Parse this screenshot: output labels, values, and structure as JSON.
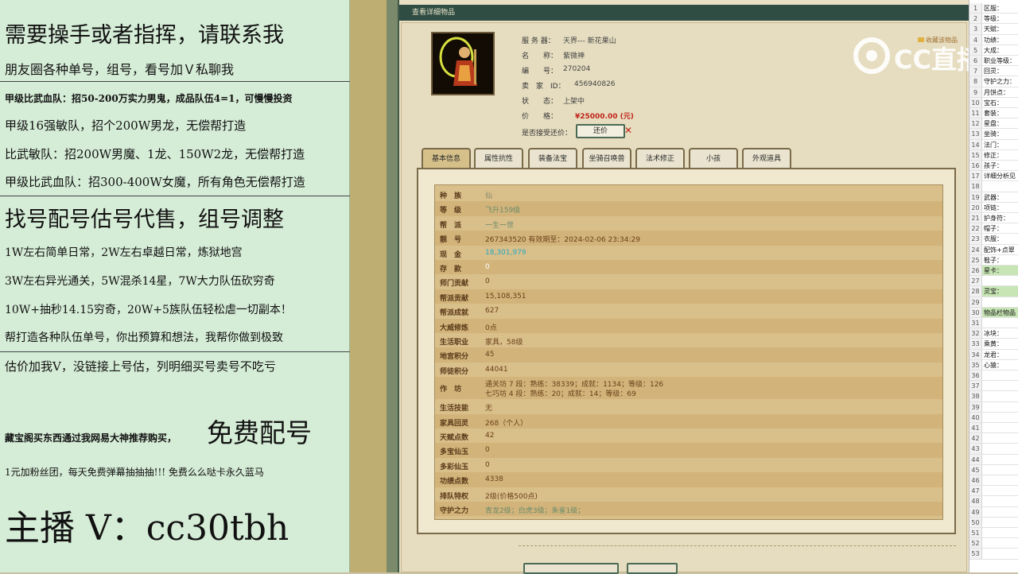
{
  "left_ad": {
    "lines": [
      "需要操手或者指挥，请联系我",
      "朋友圈各种单号，组号，看号加Ｖ私聊我",
      "甲级比武血队：招50-200万实力男鬼，成品队伍4=1，可慢慢投资",
      "甲级16强敏队，招个200W男龙，无偿帮打造",
      "比武敏队：招200W男魔、1龙、150W2龙，无偿帮打造",
      "甲级比武血队：招300-400W女魔，所有角色无偿帮打造",
      "找号配号估号代售，组号调整",
      "1W左右简单日常，2W左右卓越日常，炼狱地宫",
      "3W左右异光通关，5W混杀14星，7W大力队伍砍穷奇",
      "10W+抽秒14.15穷奇，20W+5族队伍轻松虐一切副本！",
      "帮打造各种队伍单号，你出预算和想法，我帮你做到极致",
      "估价加我V，没链接上号估，列明细买号卖号不吃亏",
      "藏宝阁买东西通过我网易大神推荐购买，",
      "免费配号",
      "1元加粉丝团，每天免费弹幕抽抽抽!!! 免费么么哒卡永久蓝马",
      "主播 V：cc30tbh"
    ]
  },
  "window": {
    "title": "查看详细物品",
    "favorite": "收藏该物品",
    "info": [
      {
        "label": "服 务 器：",
        "value": "天界--- 新花果山"
      },
      {
        "label": "名　　称：",
        "value": "紫微神"
      },
      {
        "label": "编　　号：",
        "value": "270204"
      },
      {
        "label": "卖　家　ID：",
        "value": "456940826"
      },
      {
        "label": "状　　态：",
        "value": "上架中"
      },
      {
        "label": "价　　格：",
        "value": "¥25000.00 (元)"
      }
    ],
    "counter_label": "是否接受还价：",
    "counter_button": "还价",
    "counter_x": "✕",
    "tabs": [
      "基本信息",
      "属性抗性",
      "装备法宝",
      "坐骑召唤兽",
      "法术修正",
      "小孩",
      "外观道具"
    ],
    "rows": [
      {
        "k": "种　族",
        "v": "仙",
        "c": "#8a8a6a"
      },
      {
        "k": "等　级",
        "v": "飞升159级",
        "c": "#6a8a6a"
      },
      {
        "k": "帮　派",
        "v": "一生一世",
        "c": "#6a8a6a"
      },
      {
        "k": "靓　号",
        "v": "267343520   有效期至：2024-02-06 23:34:29",
        "c": "#6a3f1a"
      },
      {
        "k": "现　金",
        "v": "18,301,979",
        "c": "#2aa8c0"
      },
      {
        "k": "存　款",
        "v": "0",
        "c": "#ffffff"
      },
      {
        "k": "师门贡献",
        "v": "0",
        "c": "#6a3f1a"
      },
      {
        "k": "帮派贡献",
        "v": "15,108,351",
        "c": "#6a3f1a"
      },
      {
        "k": "帮派成就",
        "v": "627",
        "c": "#6a3f1a"
      },
      {
        "k": "大威修炼",
        "v": "0点",
        "c": "#6a3f1a"
      },
      {
        "k": "生活职业",
        "v": "家具，58级",
        "c": "#6a3f1a"
      },
      {
        "k": "地宫积分",
        "v": "45",
        "c": "#6a3f1a"
      },
      {
        "k": "师徒积分",
        "v": "44041",
        "c": "#6a3f1a"
      },
      {
        "k": "作　坊",
        "v": "通关坊 7 段：熟练：38339；成就：1134；等级：126",
        "v2": "七巧坊 4 段：熟练：20；成就：14；等级：69",
        "c": "#6a3f1a"
      },
      {
        "k": "生活技能",
        "v": "无",
        "c": "#6a3f1a"
      },
      {
        "k": "家具回灵",
        "v": "268（个人）",
        "c": "#6a3f1a"
      },
      {
        "k": "天赋点数",
        "v": "42",
        "c": "#6a3f1a"
      },
      {
        "k": "多宝仙玉",
        "v": "0",
        "c": "#6a3f1a"
      },
      {
        "k": "多彩仙玉",
        "v": "0",
        "c": "#6a3f1a"
      },
      {
        "k": "功绩点数",
        "v": "4338",
        "c": "#6a3f1a"
      },
      {
        "k": "排队特权",
        "v": "2级(价格500点)",
        "c": "#6a3f1a"
      },
      {
        "k": "守护之力",
        "v": "青龙2级；白虎3级；朱雀1级；",
        "c": "#6a8a6a"
      }
    ]
  },
  "logo": {
    "text": "CC直播"
  },
  "sheet": {
    "rows": [
      {
        "n": "1",
        "t": "区服："
      },
      {
        "n": "2",
        "t": "等级："
      },
      {
        "n": "3",
        "t": "天赋："
      },
      {
        "n": "4",
        "t": "功绩："
      },
      {
        "n": "5",
        "t": "大成："
      },
      {
        "n": "6",
        "t": "职业等级："
      },
      {
        "n": "7",
        "t": "回灵："
      },
      {
        "n": "8",
        "t": "守护之力："
      },
      {
        "n": "9",
        "t": "月饼点："
      },
      {
        "n": "10",
        "t": "宝石："
      },
      {
        "n": "11",
        "t": "套装："
      },
      {
        "n": "12",
        "t": "星盘："
      },
      {
        "n": "13",
        "t": "坐骑："
      },
      {
        "n": "14",
        "t": "法门："
      },
      {
        "n": "15",
        "t": "修正："
      },
      {
        "n": "16",
        "t": "孩子："
      },
      {
        "n": "17",
        "t": "详细分析见"
      },
      {
        "n": "18",
        "t": ""
      },
      {
        "n": "19",
        "t": "武器："
      },
      {
        "n": "20",
        "t": "项链："
      },
      {
        "n": "21",
        "t": "护身符："
      },
      {
        "n": "22",
        "t": "帽子："
      },
      {
        "n": "23",
        "t": "衣服："
      },
      {
        "n": "24",
        "t": "配饰+点翠"
      },
      {
        "n": "25",
        "t": "鞋子："
      },
      {
        "n": "26",
        "t": "星卡：",
        "hl": true
      },
      {
        "n": "27",
        "t": ""
      },
      {
        "n": "28",
        "t": "灵宝：",
        "hl": true
      },
      {
        "n": "29",
        "t": ""
      },
      {
        "n": "30",
        "t": "物品栏物品",
        "hl": true
      },
      {
        "n": "31",
        "t": ""
      },
      {
        "n": "32",
        "t": "冰块："
      },
      {
        "n": "33",
        "t": "乘黄："
      },
      {
        "n": "34",
        "t": "龙君："
      },
      {
        "n": "35",
        "t": "心猿："
      },
      {
        "n": "36",
        "t": ""
      },
      {
        "n": "37",
        "t": ""
      },
      {
        "n": "38",
        "t": ""
      },
      {
        "n": "39",
        "t": ""
      },
      {
        "n": "40",
        "t": ""
      },
      {
        "n": "41",
        "t": ""
      },
      {
        "n": "42",
        "t": ""
      },
      {
        "n": "43",
        "t": ""
      },
      {
        "n": "44",
        "t": ""
      },
      {
        "n": "45",
        "t": ""
      },
      {
        "n": "46",
        "t": ""
      },
      {
        "n": "47",
        "t": ""
      },
      {
        "n": "48",
        "t": ""
      },
      {
        "n": "49",
        "t": ""
      },
      {
        "n": "50",
        "t": ""
      },
      {
        "n": "51",
        "t": ""
      },
      {
        "n": "52",
        "t": ""
      },
      {
        "n": "53",
        "t": ""
      }
    ]
  }
}
